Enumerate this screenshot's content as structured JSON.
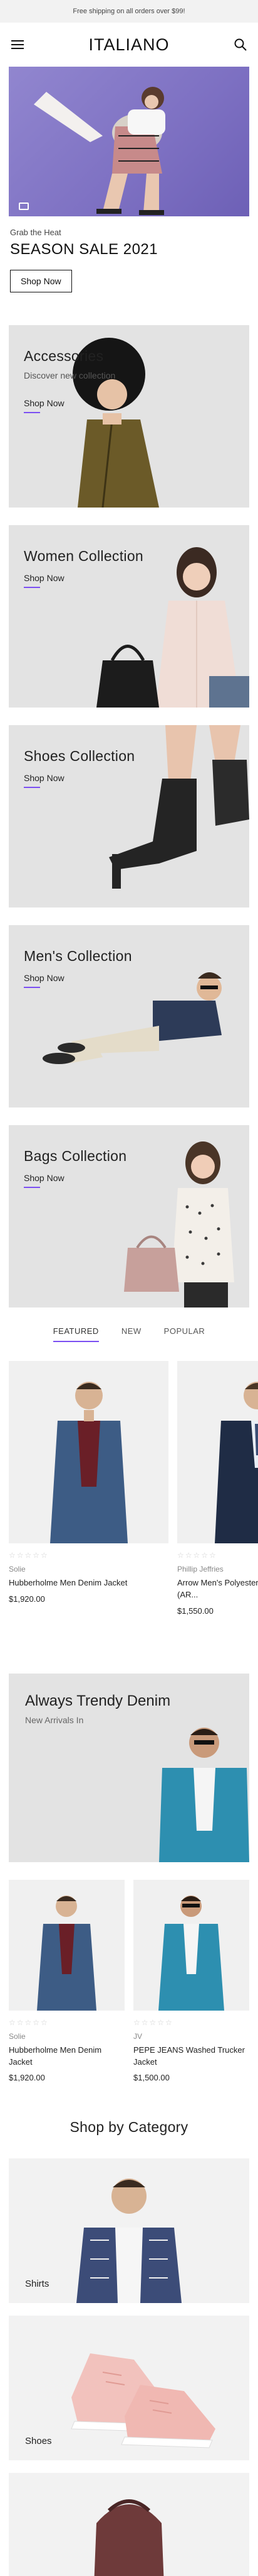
{
  "topbar": {
    "text": "Free shipping on all orders over $99!"
  },
  "header": {
    "logo": "ITALIANO"
  },
  "hero": {
    "kicker": "Grab the Heat",
    "title": "SEASON SALE 2021",
    "button": "Shop Now"
  },
  "collections": [
    {
      "title": "Accessories",
      "subtitle": "Discover new collection",
      "link": "Shop Now"
    },
    {
      "title": "Women Collection",
      "link": "Shop Now"
    },
    {
      "title": "Shoes Collection",
      "link": "Shop Now"
    },
    {
      "title": "Men's Collection",
      "link": "Shop Now"
    },
    {
      "title": "Bags Collection",
      "link": "Shop Now"
    }
  ],
  "tabs": [
    "FEATURED",
    "NEW",
    "POPULAR"
  ],
  "featured": [
    {
      "brand": "Solie",
      "name": "Hubberholme Men Denim Jacket",
      "price": "$1,920.00"
    },
    {
      "brand": "Phillip Jeffries",
      "name": "Arrow Men's Polyester Checkered Suit (AR...",
      "price": "$1,550.00"
    }
  ],
  "promo": {
    "title": "Always Trendy Denim",
    "subtitle": "New Arrivals In"
  },
  "grid": [
    {
      "brand": "Solie",
      "name": "Hubberholme Men Denim Jacket",
      "price": "$1,920.00"
    },
    {
      "brand": "JV",
      "name": "PEPE JEANS Washed Trucker Jacket",
      "price": "$1,500.00"
    }
  ],
  "shop_by_category": {
    "title": "Shop by Category",
    "categories": [
      "Shirts",
      "Shoes"
    ]
  },
  "rating_stars": "☆☆☆☆☆",
  "colors": {
    "accent": "#7b4ff2",
    "hero_bg": "#8a7ecb",
    "card_bg": "#e3e3e3"
  }
}
